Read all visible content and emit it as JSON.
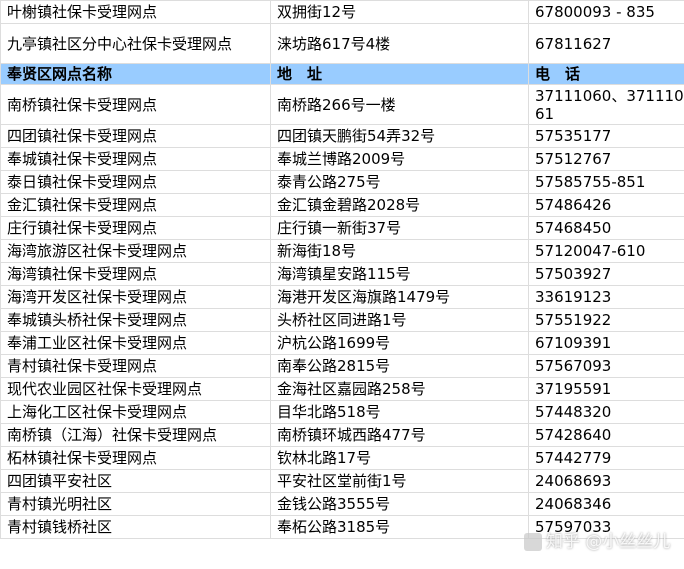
{
  "top_rows": [
    {
      "name": "叶榭镇社保卡受理网点",
      "address": "双拥街12号",
      "phone": "67800093 - 835"
    },
    {
      "name": "九亭镇社区分中心社保卡受理网点",
      "address": "涞坊路617号4楼",
      "phone": "67811627"
    }
  ],
  "section_header": {
    "name": "奉贤区网点名称",
    "address": "地　址",
    "phone": "电　话",
    "color": "#99ccff"
  },
  "rows": [
    {
      "name": "南桥镇社保卡受理网点",
      "address": "南桥路266号一楼",
      "phone": "37111060、37111061"
    },
    {
      "name": "四团镇社保卡受理网点",
      "address": "四团镇天鹏街54弄32号",
      "phone": "57535177"
    },
    {
      "name": "奉城镇社保卡受理网点",
      "address": "奉城兰博路2009号",
      "phone": "57512767"
    },
    {
      "name": "泰日镇社保卡受理网点",
      "address": "泰青公路275号",
      "phone": "57585755-851"
    },
    {
      "name": "金汇镇社保卡受理网点",
      "address": "金汇镇金碧路2028号",
      "phone": "57486426"
    },
    {
      "name": "庄行镇社保卡受理网点",
      "address": "庄行镇一新街37号",
      "phone": "57468450"
    },
    {
      "name": "海湾旅游区社保卡受理网点",
      "address": "新海街18号",
      "phone": "57120047-610"
    },
    {
      "name": "海湾镇社保卡受理网点",
      "address": "海湾镇星安路115号",
      "phone": "57503927"
    },
    {
      "name": "海湾开发区社保卡受理网点",
      "address": "海港开发区海旗路1479号",
      "phone": "33619123"
    },
    {
      "name": "奉城镇头桥社保卡受理网点",
      "address": "头桥社区同进路1号",
      "phone": "57551922"
    },
    {
      "name": "奉浦工业区社保卡受理网点",
      "address": "沪杭公路1699号",
      "phone": "67109391"
    },
    {
      "name": "青村镇社保卡受理网点",
      "address": "南奉公路2815号",
      "phone": "57567093"
    },
    {
      "name": "现代农业园区社保卡受理网点",
      "address": "金海社区嘉园路258号",
      "phone": "37195591"
    },
    {
      "name": "上海化工区社保卡受理网点",
      "address": "目华北路518号",
      "phone": "57448320"
    },
    {
      "name": "南桥镇（江海）社保卡受理网点",
      "address": "南桥镇环城西路477号",
      "phone": "57428640"
    },
    {
      "name": "柘林镇社保卡受理网点",
      "address": "钦林北路17号",
      "phone": "57442779"
    },
    {
      "name": "四团镇平安社区",
      "address": "平安社区堂前街1号",
      "phone": "24068693"
    },
    {
      "name": "青村镇光明社区",
      "address": "金钱公路3555号",
      "phone": "24068346"
    },
    {
      "name": "青村镇钱桥社区",
      "address": "奉柘公路3185号",
      "phone": "57597033"
    }
  ],
  "watermark": {
    "text": "知乎 @小丝丝儿"
  }
}
